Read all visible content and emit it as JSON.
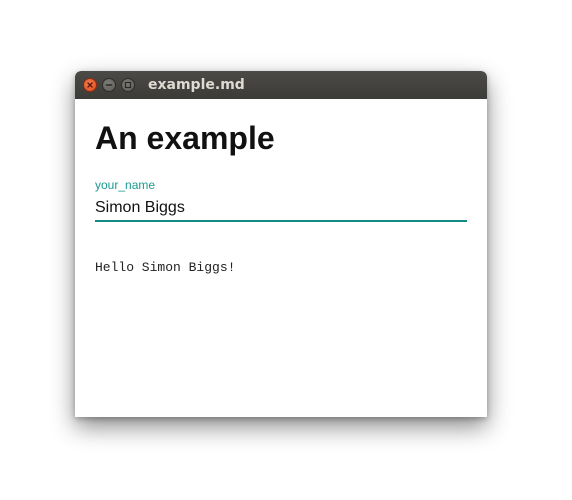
{
  "window": {
    "title": "example.md",
    "buttons": {
      "close": "close-icon",
      "minimize": "minimize-icon",
      "maximize": "maximize-icon"
    }
  },
  "content": {
    "heading": "An example",
    "field": {
      "label": "your_name",
      "value": "Simon Biggs"
    },
    "output": "Hello Simon Biggs!"
  },
  "colors": {
    "accent": "#138a82",
    "label": "#1a9a92",
    "titlebar": "#3c3b37",
    "close_button": "#df4a16"
  }
}
